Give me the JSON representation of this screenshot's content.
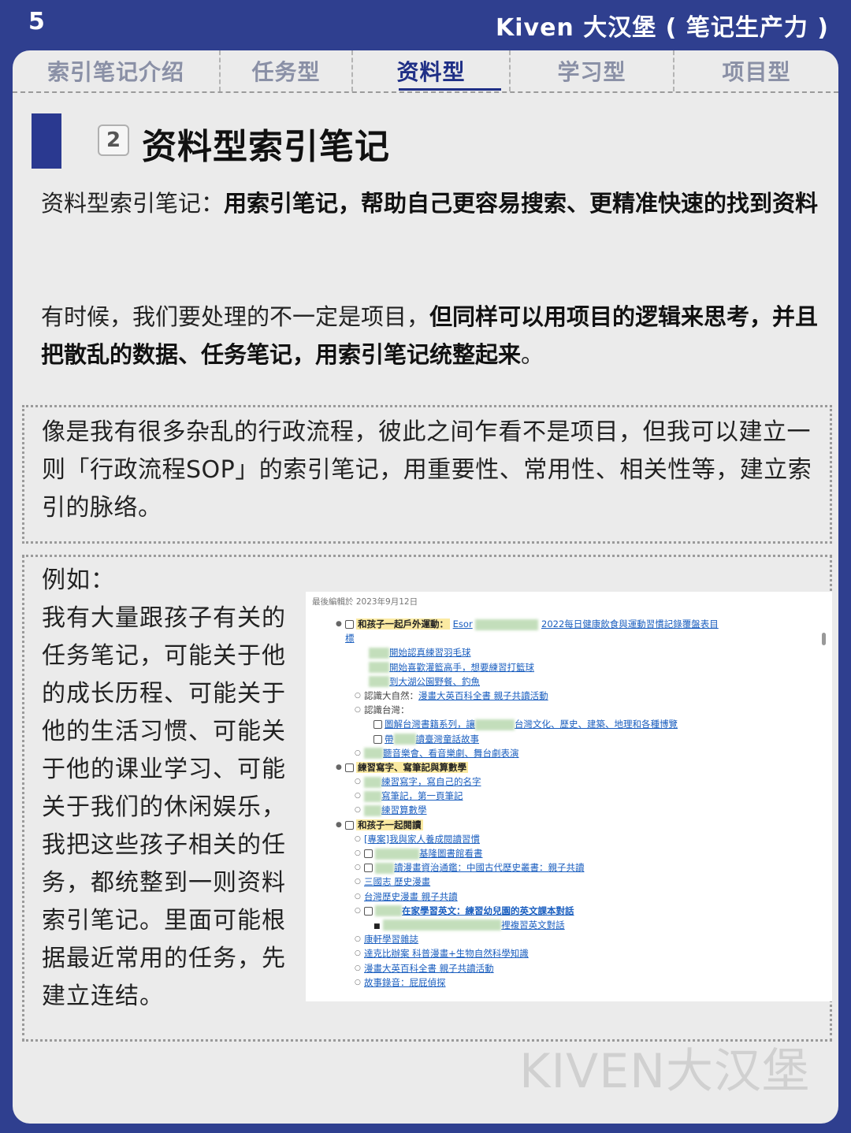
{
  "header": {
    "page_number": "5",
    "brand": "Kiven 大汉堡 ( 笔记生产力 )"
  },
  "tabs": [
    {
      "label": "索引笔记介绍",
      "active": false
    },
    {
      "label": "任务型",
      "active": false
    },
    {
      "label": "资料型",
      "active": true
    },
    {
      "label": "学习型",
      "active": false
    },
    {
      "label": "项目型",
      "active": false
    }
  ],
  "section": {
    "number": "2",
    "title": "资料型索引笔记"
  },
  "intro": {
    "lead": "资料型索引笔记：",
    "bold": "用索引笔记，帮助自己更容易搜索、更精准快速的找到资料"
  },
  "para2": {
    "lead": "有时候，我们要处理的不一定是项目，",
    "bold": "但同样可以用项目的逻辑来思考，并且把散乱的数据、任务笔记，用索引笔记统整起来",
    "tail": "。"
  },
  "box1_text": "像是我有很多杂乱的行政流程，彼此之间乍看不是项目，但我可以建立一则「行政流程SOP」的索引笔记，用重要性、常用性、相关性等，建立索引的脉络。",
  "box2": {
    "label": "例如：",
    "text": "我有大量跟孩子有关的任务笔记，可能关于他的成长历程、可能关于他的生活习惯、可能关于他的课业学习、可能关于我们的休闲娱乐，我把这些孩子相关的任务，都统整到一则资料索引笔记。里面可能根据最近常用的任务，先建立连结。"
  },
  "screenshot": {
    "meta": "最後編輯於 2023年9月12日",
    "rows": {
      "r1_hl": "和孩子一起戶外運動：",
      "r1_a": "Esor",
      "r1_b": "2022每日健康飲食與運動習慣記錄覆盤表目",
      "r1_c": "標",
      "r2": "開始認真練習羽毛球",
      "r3": "開始喜歡灌籃高手，想要練習打籃球",
      "r4": "到大湖公園野餐、釣魚",
      "r5_lead": "認識大自然：",
      "r5": "漫畫大英百科全書 親子共讀活動",
      "r6": "認識台灣：",
      "r7_a": "圖解台灣書籍系列，讓",
      "r7_b": "台灣文化、歷史、建築、地理和各種博覽",
      "r8_a": "帶",
      "r8_b": "讀臺灣童話故事",
      "r9": "聽音樂會、看音樂劇、舞台劇表演",
      "r10_hl": "練習寫字、寫筆記與算數學",
      "r11": "練習寫字，寫自己的名字",
      "r12": "寫筆記，第一頁筆記",
      "r13": "練習算數學",
      "r14_hl": "和孩子一起閱讀",
      "r15": "[專案]我與家人養成閱讀習慣",
      "r16": "基隆圖書館看書",
      "r17": "讀漫畫資治通鑑：中國古代歷史叢書：親子共讀",
      "r18": "三國志 歷史漫畫",
      "r19": "台灣歷史漫畫 親子共讀",
      "r20": "在家學習英文：練習幼兒園的英文課本對話",
      "r21": "裡複習英文對話",
      "r22": "康軒學習雜誌",
      "r23": "達克比辦案 科普漫畫+生物自然科學知識",
      "r24": "漫畫大英百科全書 親子共讀活動",
      "r25": "故事錄音：屁屁偵探"
    }
  },
  "watermark": "KIVEN大汉堡",
  "colors": {
    "brand_blue": "#2f3f8f",
    "card_bg": "#ebebeb",
    "highlight": "#fbeaa2"
  }
}
